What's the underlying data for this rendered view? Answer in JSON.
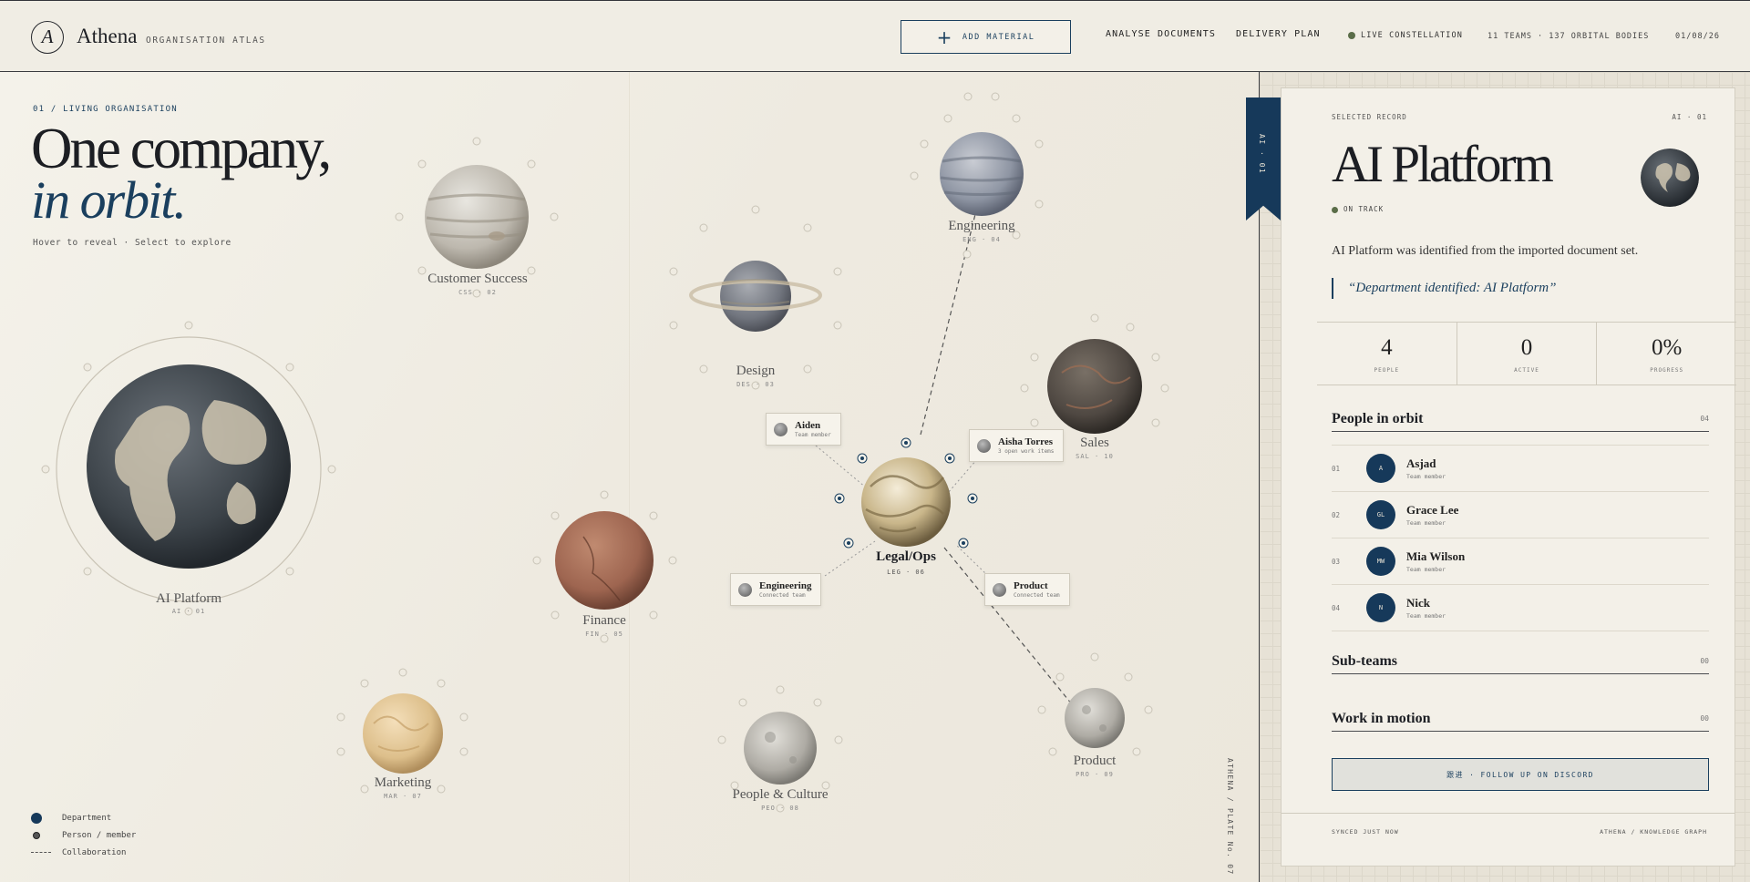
{
  "app": {
    "brand": "Athena",
    "tagline": "ORGANISATION ATLAS",
    "logo_letter": "A"
  },
  "header": {
    "add_material": "ADD MATERIAL",
    "nav": [
      "ANALYSE DOCUMENTS",
      "DELIVERY PLAN"
    ],
    "live": "LIVE CONSTELLATION",
    "stats": "11 TEAMS · 137 ORBITAL BODIES",
    "date": "01/08/26"
  },
  "canvas": {
    "section_tag": "01 / LIVING ORGANISATION",
    "hero_line1": "One company,",
    "hero_line2": "in orbit.",
    "hint": "Hover to reveal · Select to explore",
    "plate": "ATHENA / PLATE No. 07"
  },
  "planets": [
    {
      "name": "AI Platform",
      "code": "AI · 01",
      "selected": true
    },
    {
      "name": "Customer Success",
      "code": "CSS · 02"
    },
    {
      "name": "Design",
      "code": "DES · 03"
    },
    {
      "name": "Engineering",
      "code": "ENG · 04"
    },
    {
      "name": "Sales",
      "code": "SAL · 10"
    },
    {
      "name": "Finance",
      "code": "FIN · 05"
    },
    {
      "name": "Legal/Ops",
      "code": "LEG · 06",
      "focused": true
    },
    {
      "name": "Marketing",
      "code": "MAR · 07"
    },
    {
      "name": "People & Culture",
      "code": "PEO · 08"
    },
    {
      "name": "Product",
      "code": "PRO · 09"
    }
  ],
  "tooltips": [
    {
      "name": "Aiden",
      "sub": "Team member"
    },
    {
      "name": "Aisha Torres",
      "sub": "3 open work items"
    },
    {
      "name": "Engineering",
      "sub": "Connected team"
    },
    {
      "name": "Product",
      "sub": "Connected team"
    }
  ],
  "legend": [
    "Department",
    "Person / member",
    "Collaboration"
  ],
  "record": {
    "label": "SELECTED RECORD",
    "code": "AI · 01",
    "bookmark": "AI · 01",
    "title": "AI Platform",
    "status": "ON TRACK",
    "description": "AI Platform was identified from the imported document set.",
    "quote": "“Department identified: AI Platform”",
    "metrics": [
      {
        "value": "4",
        "label": "PEOPLE"
      },
      {
        "value": "0",
        "label": "ACTIVE"
      },
      {
        "value": "0%",
        "label": "PROGRESS"
      }
    ],
    "people_title": "People in orbit",
    "people_count": "04",
    "people": [
      {
        "index": "01",
        "initials": "A",
        "name": "Asjad",
        "role": "Team member"
      },
      {
        "index": "02",
        "initials": "GL",
        "name": "Grace Lee",
        "role": "Team member"
      },
      {
        "index": "03",
        "initials": "MW",
        "name": "Mia Wilson",
        "role": "Team member"
      },
      {
        "index": "04",
        "initials": "N",
        "name": "Nick",
        "role": "Team member"
      }
    ],
    "subteams_title": "Sub-teams",
    "subteams_count": "00",
    "work_title": "Work in motion",
    "work_count": "00",
    "discord": "跟进 · FOLLOW UP ON DISCORD",
    "synced": "SYNCED JUST NOW",
    "footer_brand": "ATHENA / KNOWLEDGE GRAPH"
  },
  "colors": {
    "accent": "#1a3f5e",
    "status": "#5a6d48",
    "background": "#efebe1"
  }
}
